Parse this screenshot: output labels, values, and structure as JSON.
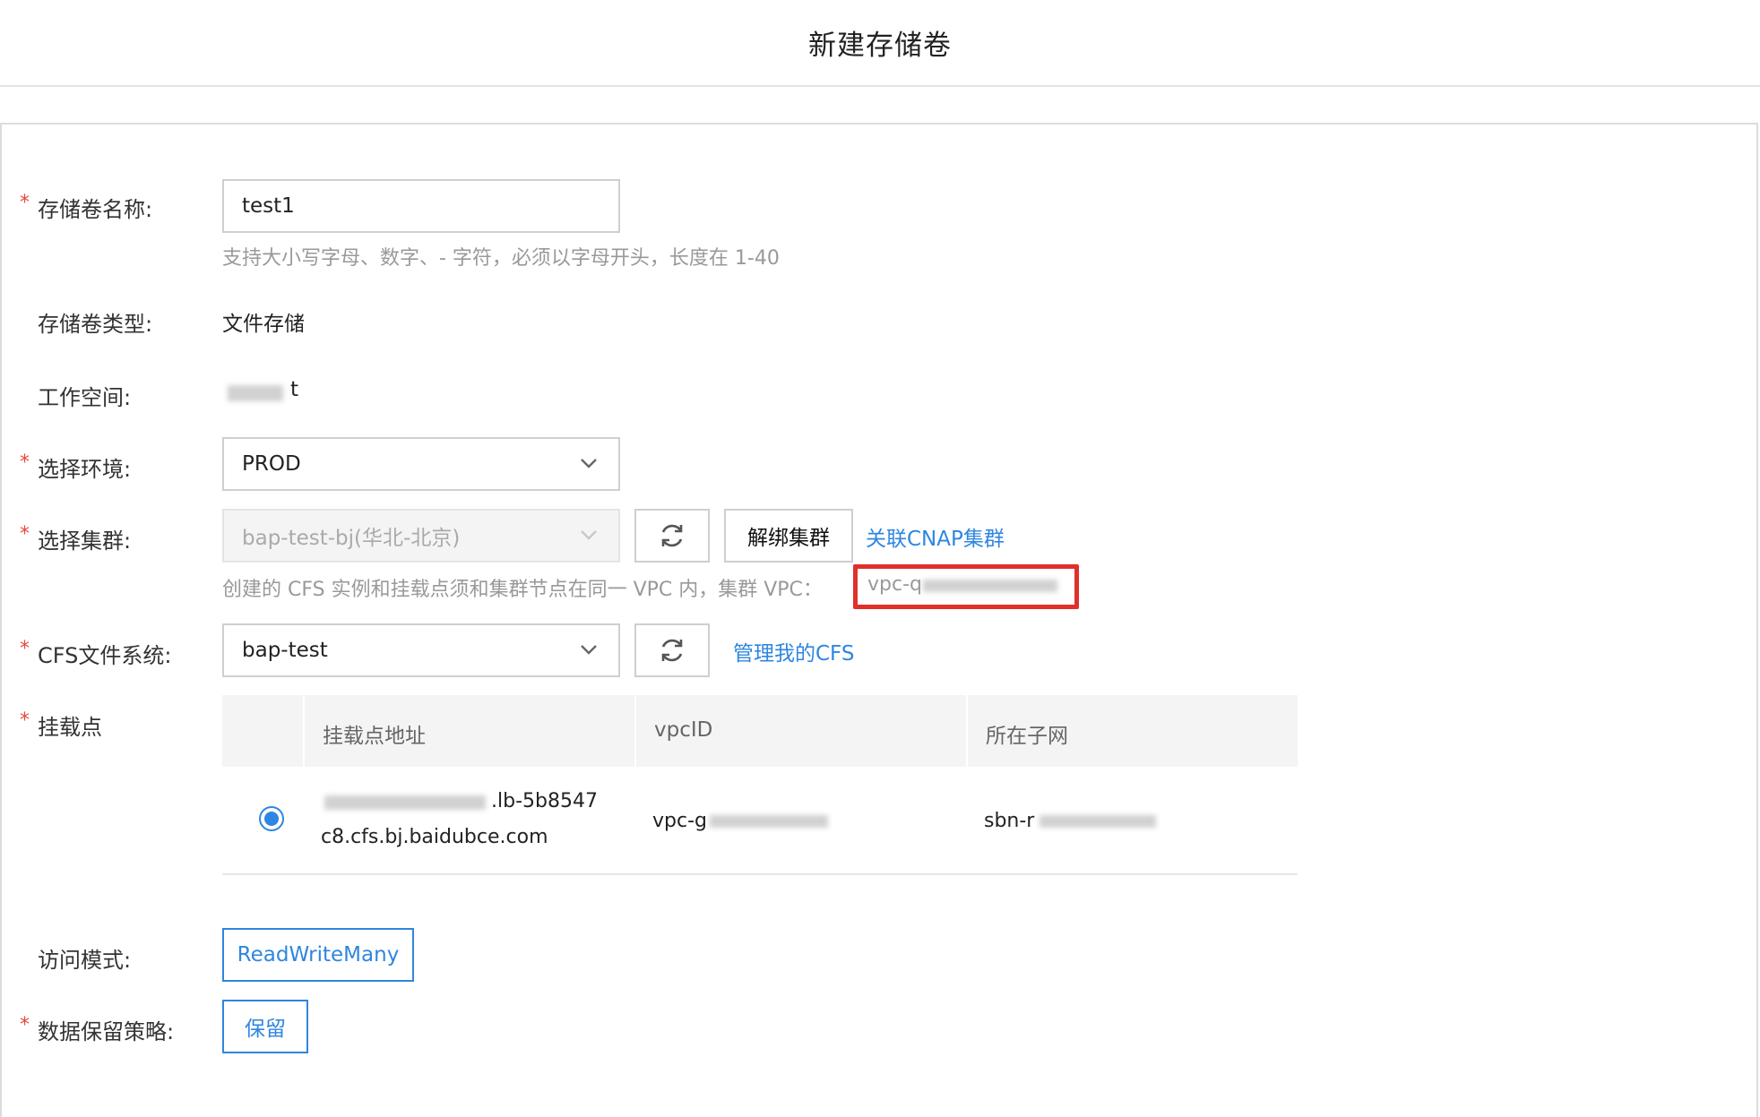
{
  "page": {
    "title": "新建存储卷"
  },
  "form": {
    "name": {
      "label": "存储卷名称:",
      "value": "test1",
      "hint": "支持大小写字母、数字、- 字符，必须以字母开头，长度在 1-40"
    },
    "type": {
      "label": "存储卷类型:",
      "value": "文件存储"
    },
    "workspace": {
      "label": "工作空间:",
      "value_suffix": "t"
    },
    "environment": {
      "label": "选择环境:",
      "value": "PROD"
    },
    "cluster": {
      "label": "选择集群:",
      "value": "bap-test-bj(华北-北京)",
      "unbind_label": "解绑集群",
      "link_label": "关联CNAP集群",
      "hint": "创建的 CFS 实例和挂载点须和集群节点在同一 VPC 内，集群 VPC：",
      "vpc_prefix": "vpc-q"
    },
    "cfs": {
      "label": "CFS文件系统:",
      "value": "bap-test",
      "link_label": "管理我的CFS"
    },
    "mount": {
      "label": "挂载点",
      "columns": [
        "挂载点地址",
        "vpcID",
        "所在子网"
      ],
      "row": {
        "address_line1_suffix": ".lb-5b8547",
        "address_line2": "c8.cfs.bj.baidubce.com",
        "vpc_prefix": "vpc-g",
        "subnet_prefix": "sbn-r"
      }
    },
    "access_mode": {
      "label": "访问模式:",
      "value": "ReadWriteMany"
    },
    "retention": {
      "label": "数据保留策略:",
      "value": "保留"
    }
  },
  "icons": {
    "refresh": "refresh-icon",
    "chevron": "chevron-down-icon"
  },
  "colors": {
    "accent": "#2f86e0",
    "required": "#e8473e",
    "highlight": "#e0302a"
  }
}
